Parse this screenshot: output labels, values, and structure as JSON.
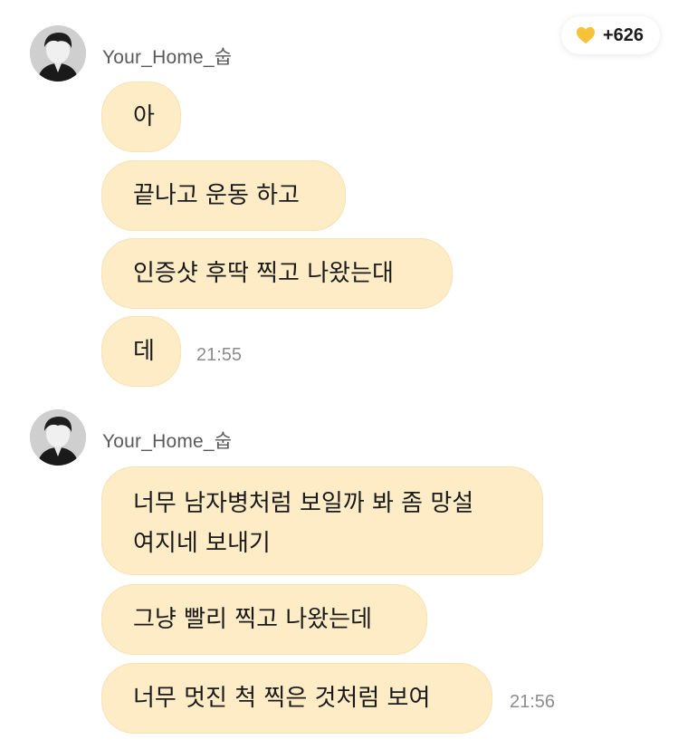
{
  "badge": {
    "icon": "heart-icon",
    "heart_color": "#f6c23a",
    "count": "+626"
  },
  "groups": [
    {
      "sender": "Your_Home_숩",
      "messages": [
        {
          "text": "아"
        },
        {
          "text": "끝나고 운동 하고"
        },
        {
          "text": "인증샷 후딱 찍고 나왔는대"
        },
        {
          "text": "데"
        }
      ],
      "time": "21:55"
    },
    {
      "sender": "Your_Home_숩",
      "messages": [
        {
          "text": "너무 남자병처럼 보일까 봐 좀 망설\n여지네 보내기"
        },
        {
          "text": "그냥 빨리 찍고 나왔는데"
        },
        {
          "text": "너무 멋진 척 찍은 것처럼 보여"
        }
      ],
      "time": "21:56"
    }
  ],
  "colors": {
    "bubble": "#fdecc6",
    "sender_name": "#5a5a5a",
    "time": "#8c8c8c"
  }
}
